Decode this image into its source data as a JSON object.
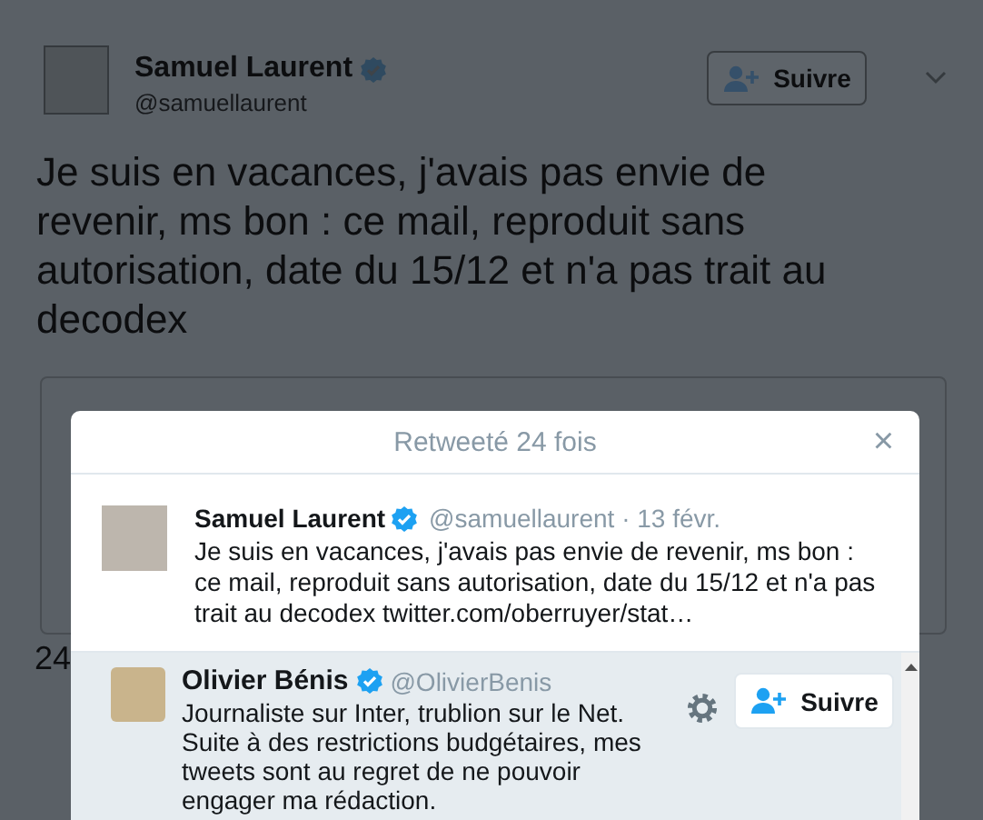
{
  "background_tweet": {
    "name": "Samuel Laurent",
    "verified": true,
    "handle": "@samuellaurent",
    "follow_button": "Suivre",
    "text": "Je suis en vacances, j'avais pas envie de revenir, ms bon : ce mail, reproduit sans autorisation, date du 15/12 et n'a pas trait au decodex",
    "retweet_count": "24"
  },
  "modal": {
    "title": "Retweeté 24 fois",
    "close": "×",
    "tweet": {
      "name": "Samuel Laurent",
      "verified": true,
      "handle": "@samuellaurent",
      "time": "· 13 févr.",
      "text": "Je suis en vacances, j'avais pas envie de revenir, ms bon : ce mail, reproduit sans autorisation, date du 15/12 et n'a pas trait au decodex",
      "link": "twitter.com/oberruyer/stat…"
    },
    "retweeters": [
      {
        "name": "Olivier Bénis",
        "verified": true,
        "handle": "@OlivierBenis",
        "bio": "Journaliste sur Inter, trublion sur le Net. Suite à des restrictions budgétaires, mes tweets sont au regret de ne pouvoir engager ma rédaction.",
        "follow_button": "Suivre"
      }
    ]
  }
}
